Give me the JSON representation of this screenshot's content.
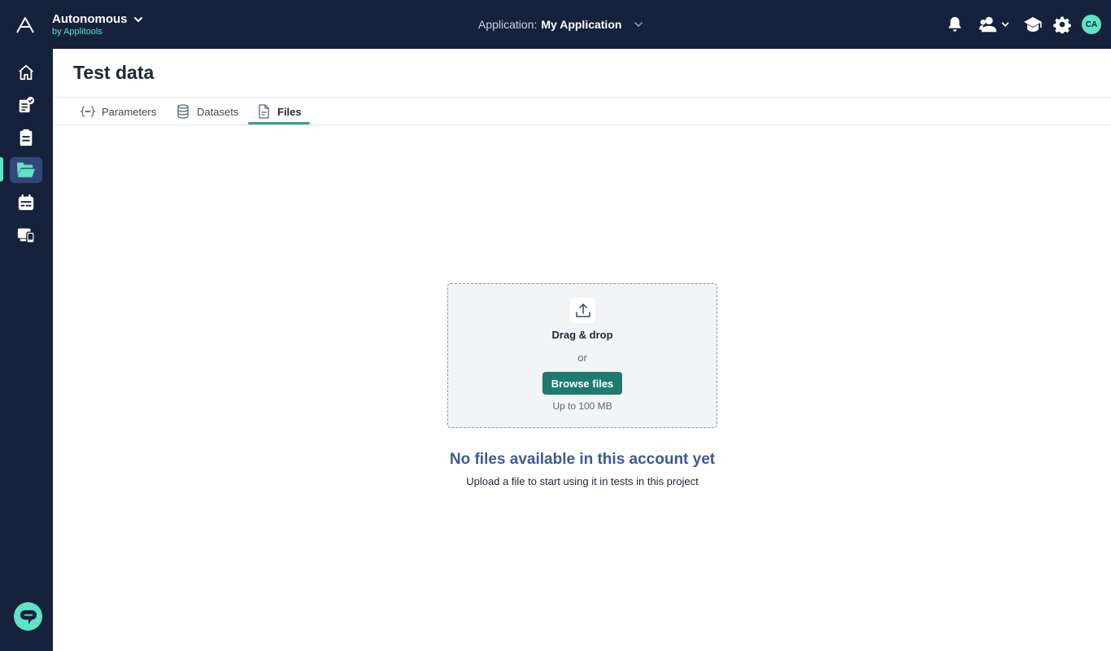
{
  "brand": {
    "name": "Autonomous",
    "sub": "by Applitools"
  },
  "app_selector": {
    "label": "Application:",
    "value": "My Application"
  },
  "user": {
    "initials": "CA"
  },
  "page": {
    "title": "Test data"
  },
  "tabs": [
    {
      "label": "Parameters",
      "icon": "braces-icon"
    },
    {
      "label": "Datasets",
      "icon": "database-icon"
    },
    {
      "label": "Files",
      "icon": "file-icon",
      "active": true
    }
  ],
  "dropzone": {
    "title": "Drag & drop",
    "or": "or",
    "button": "Browse files",
    "limit": "Up to 100 MB"
  },
  "empty_state": {
    "title": "No files available in this account yet",
    "subtitle": "Upload a file to start using it in tests in this project"
  },
  "colors": {
    "topbar": "#16213c",
    "accent": "#5fe3c5",
    "button": "#1f7a70",
    "empty_title": "#3b5b95"
  }
}
